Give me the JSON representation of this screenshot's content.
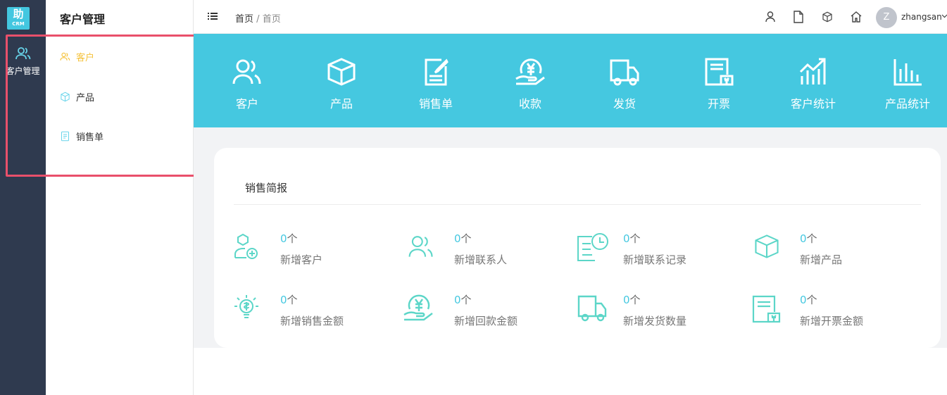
{
  "rail": {
    "logo_main": "助",
    "logo_sub": "CRM",
    "module_label": "客户管理"
  },
  "sidebar": {
    "title": "客户管理",
    "items": [
      {
        "label": "客户",
        "icon": "customers-icon",
        "active": true
      },
      {
        "label": "产品",
        "icon": "box-icon",
        "active": false
      },
      {
        "label": "销售单",
        "icon": "order-icon",
        "active": false
      }
    ],
    "active_color": "#f5c23a"
  },
  "header": {
    "breadcrumb": {
      "root": "首页",
      "separator": "/",
      "current": "首页"
    },
    "icons": [
      "user-icon",
      "file-icon",
      "box-icon",
      "home-icon"
    ],
    "avatar_letter": "Z",
    "username": "zhangsan"
  },
  "banner": {
    "color": "#45c8e0",
    "tiles": [
      {
        "label": "客户",
        "icon": "customers-icon"
      },
      {
        "label": "产品",
        "icon": "box-icon"
      },
      {
        "label": "销售单",
        "icon": "edit-document-icon"
      },
      {
        "label": "收款",
        "icon": "payment-icon"
      },
      {
        "label": "发货",
        "icon": "truck-icon"
      },
      {
        "label": "开票",
        "icon": "invoice-icon"
      },
      {
        "label": "客户统计",
        "icon": "trend-chart-icon"
      },
      {
        "label": "产品统计",
        "icon": "bar-chart-icon"
      }
    ]
  },
  "report": {
    "title": "销售简报",
    "unit": "个",
    "stats": [
      {
        "value": "0",
        "label": "新增客户",
        "icon": "add-user-icon"
      },
      {
        "value": "0",
        "label": "新增联系人",
        "icon": "contacts-icon"
      },
      {
        "value": "0",
        "label": "新增联系记录",
        "icon": "record-clock-icon"
      },
      {
        "value": "0",
        "label": "新增产品",
        "icon": "box-icon"
      },
      {
        "value": "0",
        "label": "新增销售金额",
        "icon": "lightbulb-money-icon"
      },
      {
        "value": "0",
        "label": "新增回款金额",
        "icon": "payment-icon"
      },
      {
        "value": "0",
        "label": "新增发货数量",
        "icon": "truck-icon"
      },
      {
        "value": "0",
        "label": "新增开票金额",
        "icon": "invoice-icon"
      }
    ]
  }
}
